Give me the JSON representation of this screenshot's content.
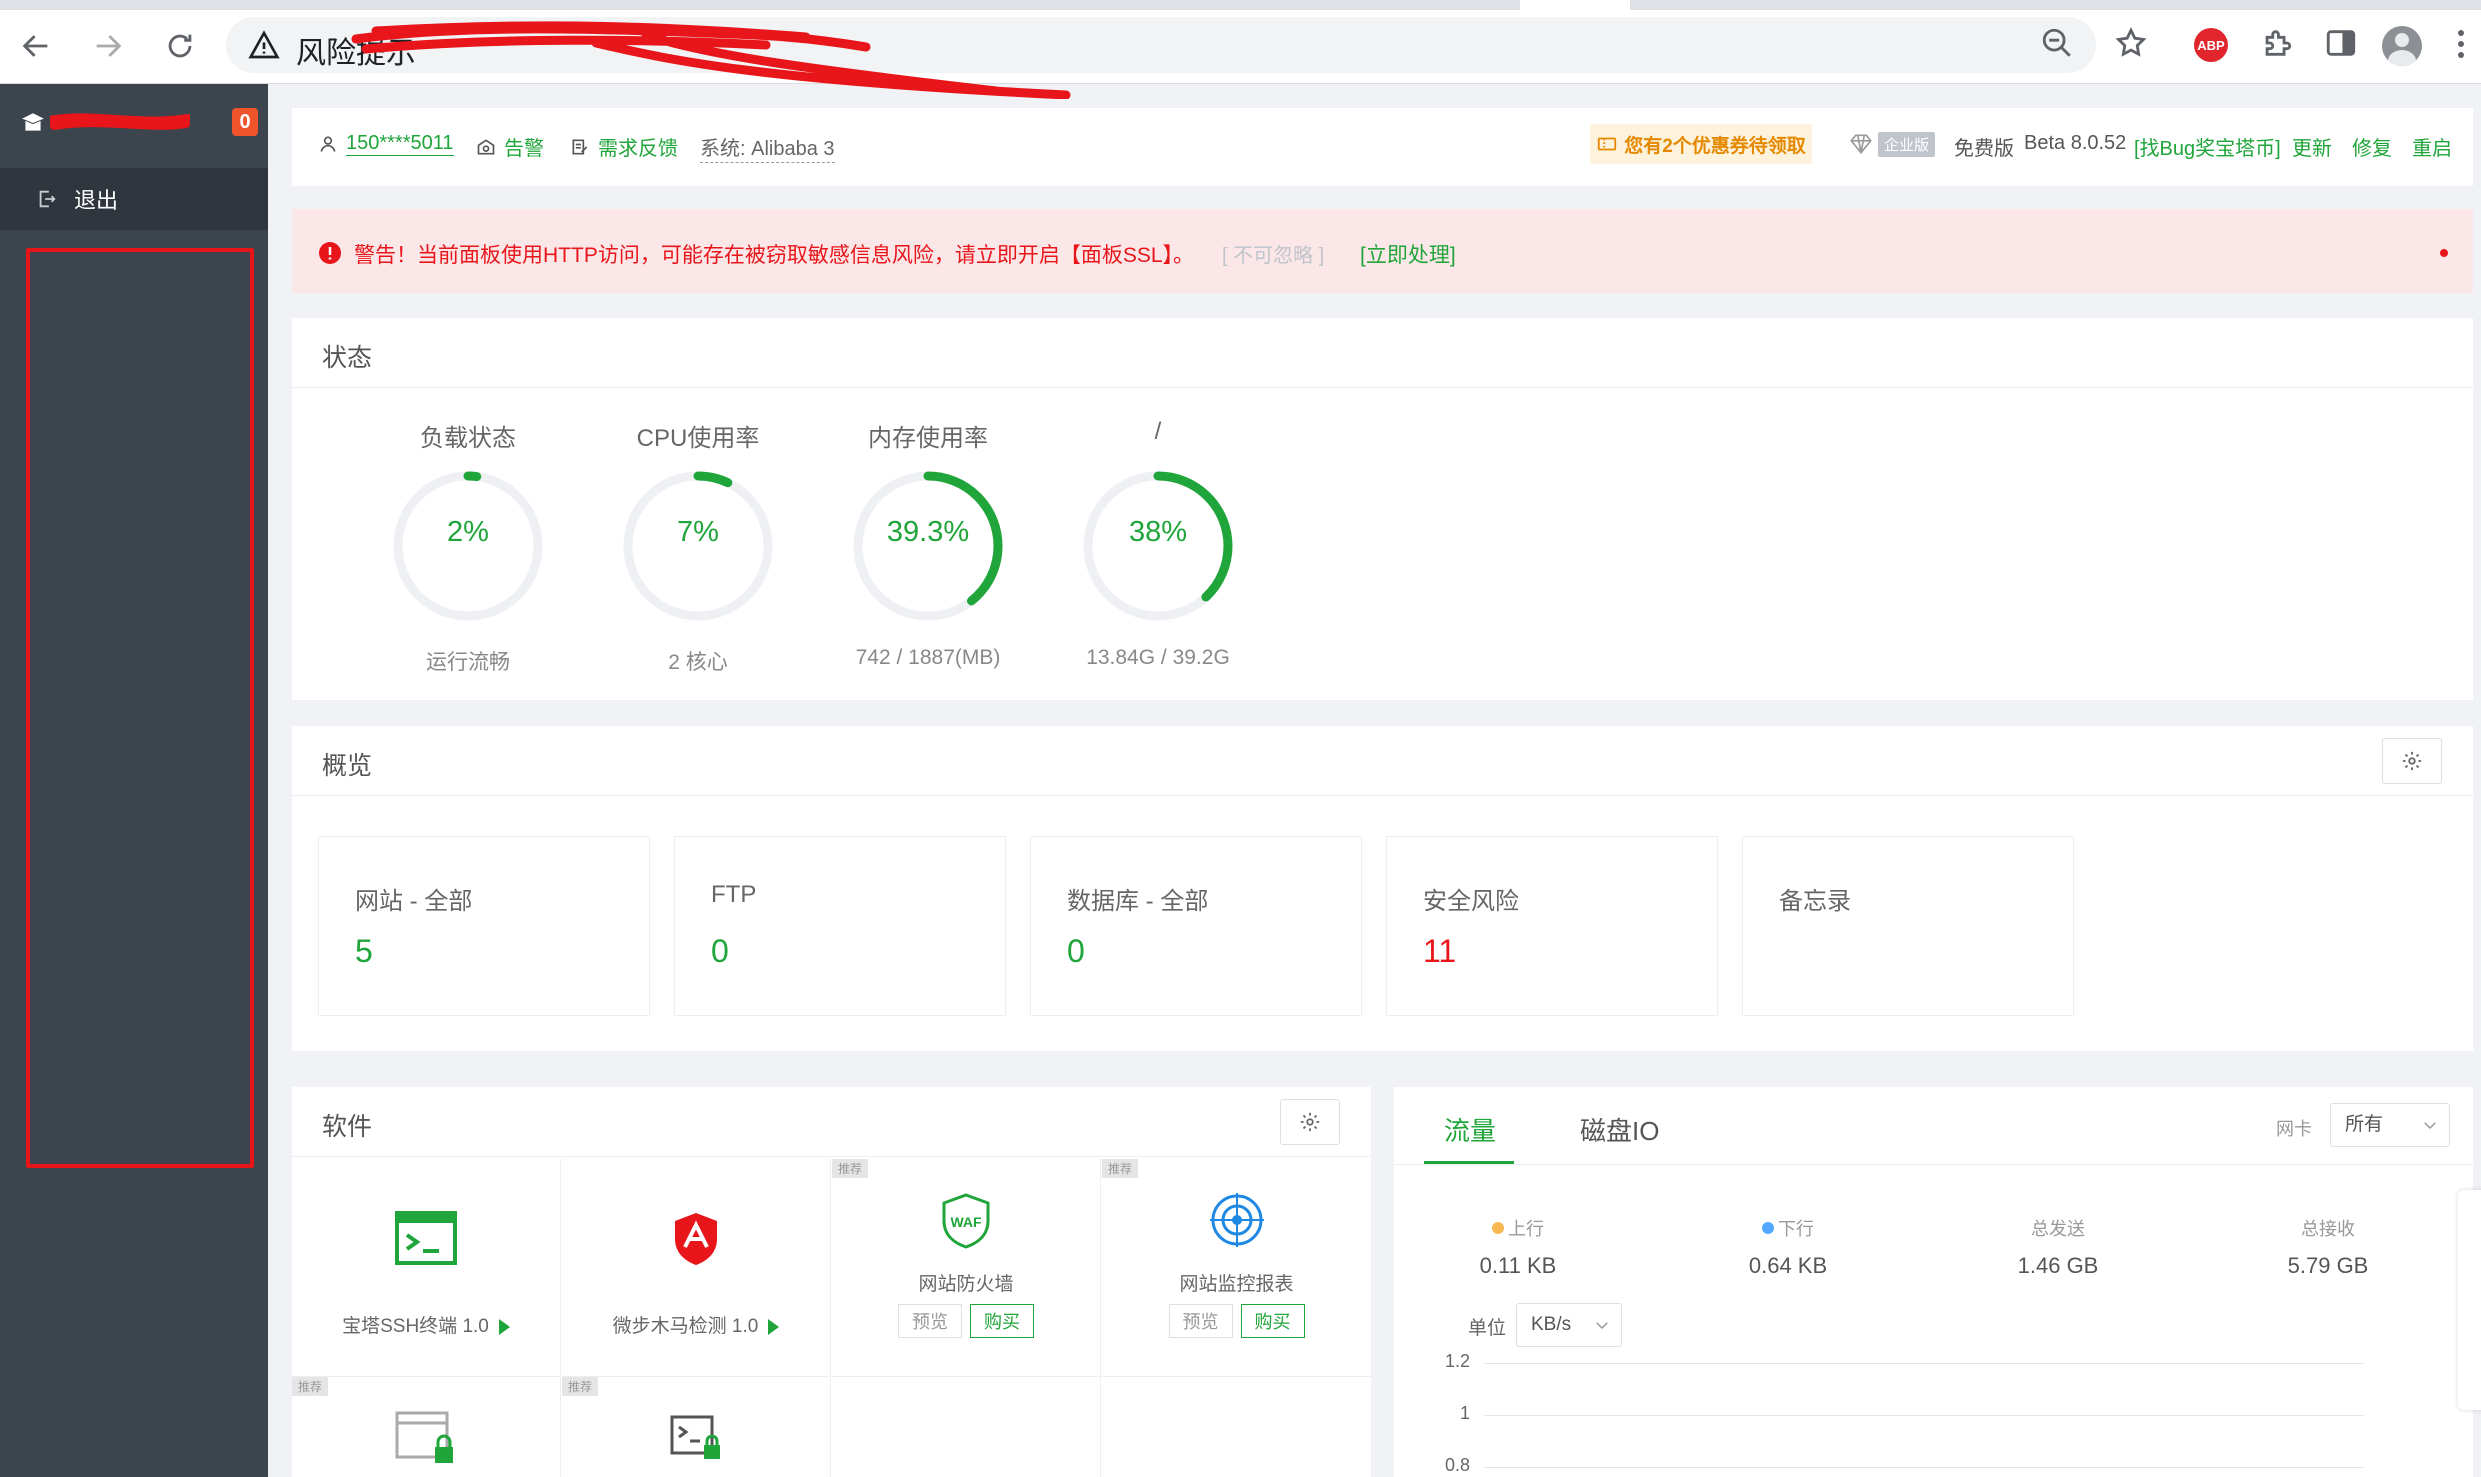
{
  "browser": {
    "url_text": "风险提示",
    "colors": {
      "chrome": "#dee1e6",
      "omnibox": "#f1f3f4"
    }
  },
  "sidebar": {
    "badge": "0",
    "items": [
      {
        "label": "退出",
        "icon": "logout-icon"
      }
    ]
  },
  "topbar": {
    "phone": "150****5011",
    "alarm": "告警",
    "feedback": "需求反馈",
    "system": "系统:  Alibaba 3",
    "coupon": "您有2个优惠券待领取",
    "enterprise_tag": "企业版",
    "edition": "免费版",
    "version": "Beta 8.0.52",
    "bug_bounty": "[找Bug奖宝塔币]",
    "update": "更新",
    "repair": "修复",
    "restart": "重启"
  },
  "alert": {
    "message": "警告！当前面板使用HTTP访问，可能存在被窃取敏感信息风险，请立即开启【面板SSL】。",
    "ignore": "[ 不可忽略 ]",
    "action": "[立即处理]"
  },
  "status": {
    "title": "状态",
    "gauges": [
      {
        "title": "负载状态",
        "value": "2%",
        "percent": 2,
        "sub": "运行流畅"
      },
      {
        "title": "CPU使用率",
        "value": "7%",
        "percent": 7,
        "sub": "2 核心"
      },
      {
        "title": "内存使用率",
        "value": "39.3%",
        "percent": 39.3,
        "sub": "742 / 1887(MB)"
      },
      {
        "title": "/",
        "value": "38%",
        "percent": 38,
        "sub": "13.84G / 39.2G"
      }
    ]
  },
  "overview": {
    "title": "概览",
    "boxes": [
      {
        "label": "网站 - 全部",
        "value": "5",
        "color": "#20a53a"
      },
      {
        "label": "FTP",
        "value": "0",
        "color": "#20a53a"
      },
      {
        "label": "数据库 - 全部",
        "value": "0",
        "color": "#20a53a"
      },
      {
        "label": "安全风险",
        "value": "11",
        "color": "#e8161b"
      },
      {
        "label": "备忘录",
        "value": "",
        "color": "#20a53a"
      }
    ]
  },
  "software": {
    "title": "软件",
    "recommend_tag": "推荐",
    "preview_label": "预览",
    "buy_label": "购买",
    "items": [
      {
        "name": "宝塔SSH终端 1.0"
      },
      {
        "name": "微步木马检测 1.0"
      },
      {
        "name": "网站防火墙"
      },
      {
        "name": "网站监控报表"
      }
    ]
  },
  "traffic": {
    "tabs": [
      "流量",
      "磁盘IO"
    ],
    "nic_label": "网卡",
    "nic_value": "所有",
    "stats": [
      {
        "label": "上行",
        "value": "0.11 KB",
        "dot": "#f7b851"
      },
      {
        "label": "下行",
        "value": "0.64 KB",
        "dot": "#52a9ff"
      },
      {
        "label": "总发送",
        "value": "1.46 GB"
      },
      {
        "label": "总接收",
        "value": "5.79 GB"
      }
    ],
    "unit_label": "单位",
    "unit_value": "KB/s",
    "y_ticks": [
      "1.2",
      "1",
      "0.8"
    ]
  },
  "theme": {
    "accent": "#20a53a",
    "danger": "#e8161b",
    "sidebar": "#3c444d"
  }
}
